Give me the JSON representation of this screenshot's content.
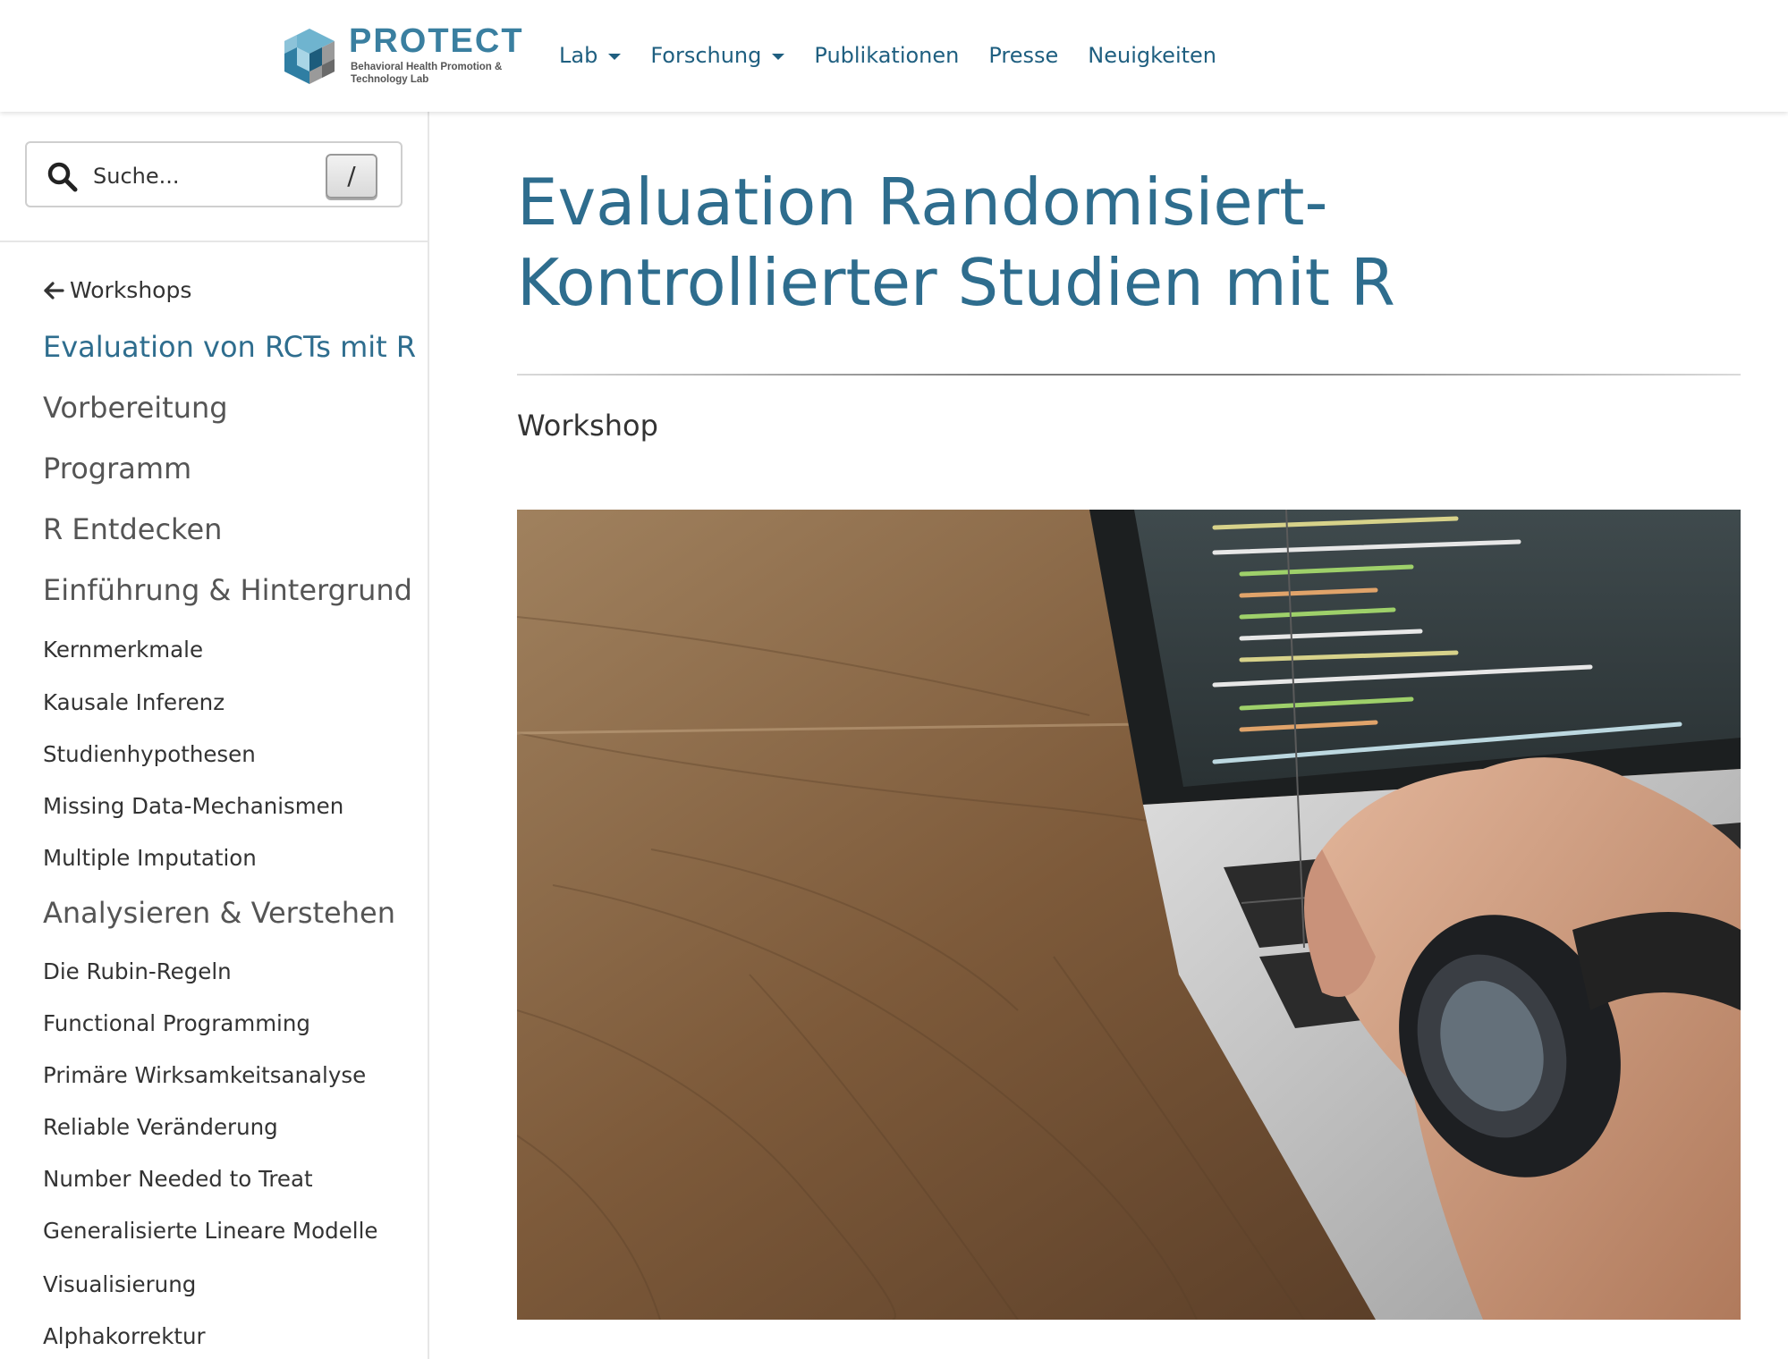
{
  "header": {
    "logo": {
      "word": "PROTECT",
      "subtitle": "Behavioral Health Promotion & Technology Lab"
    },
    "nav": [
      {
        "label": "Lab",
        "dropdown": true
      },
      {
        "label": "Forschung",
        "dropdown": true
      },
      {
        "label": "Publikationen",
        "dropdown": false
      },
      {
        "label": "Presse",
        "dropdown": false
      },
      {
        "label": "Neuigkeiten",
        "dropdown": false
      }
    ]
  },
  "sidebar": {
    "search": {
      "placeholder": "Suche...",
      "shortcut": "/"
    },
    "back_label": "Workshops",
    "items": [
      {
        "label": "Evaluation von RCTs mit R",
        "level": "big",
        "active": true
      },
      {
        "label": "Vorbereitung",
        "level": "big"
      },
      {
        "label": "Programm",
        "level": "big"
      },
      {
        "label": "R Entdecken",
        "level": "big"
      },
      {
        "label": "Einführung & Hintergrund",
        "level": "big"
      },
      {
        "label": "Kernmerkmale",
        "level": "small"
      },
      {
        "label": "Kausale Inferenz",
        "level": "small"
      },
      {
        "label": "Studienhypothesen",
        "level": "small"
      },
      {
        "label": "Missing Data-Mechanismen",
        "level": "small"
      },
      {
        "label": "Multiple Imputation",
        "level": "small"
      },
      {
        "label": "Analysieren & Verstehen",
        "level": "big"
      },
      {
        "label": "Die Rubin-Regeln",
        "level": "small"
      },
      {
        "label": "Functional Programming",
        "level": "small"
      },
      {
        "label": "Primäre Wirksamkeitsanalyse",
        "level": "small"
      },
      {
        "label": "Reliable Veränderung",
        "level": "small"
      },
      {
        "label": "Number Needed to Treat",
        "level": "small"
      },
      {
        "label": "Generalisierte Lineare Modelle",
        "level": "small"
      },
      {
        "label": "Visualisierung",
        "level": "small"
      },
      {
        "label": "Alphakorrektur",
        "level": "small"
      }
    ]
  },
  "main": {
    "title": "Evaluation Randomisiert-Kontrollierter Studien mit R",
    "subtitle": "Workshop",
    "colors": {
      "accent": "#2e6d8e",
      "nav": "#1f5f80"
    }
  }
}
